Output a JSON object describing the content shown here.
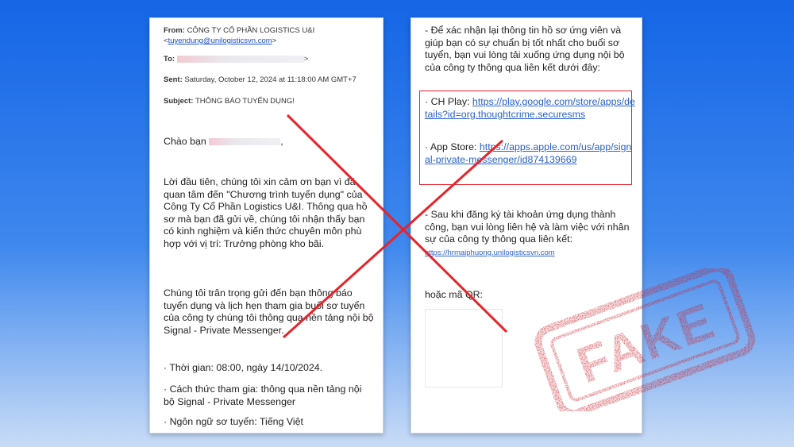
{
  "left": {
    "from_label": "From:",
    "from_value": "CÔNG TY CỔ PHẦN LOGISTICS U&I",
    "from_email": "tuyendung@unilogisticsvn.com",
    "to_label": "To:",
    "sent_label": "Sent:",
    "sent_value": "Saturday, October 12, 2024 at 11:18:00 AM GMT+7",
    "subject_label": "Subject:",
    "subject_value": "THÔNG BÁO TUYỂN DỤNG!",
    "greeting": "Chào bạn",
    "para1": "Lời đầu tiên, chúng tôi xin cảm ơn bạn vì đã quan tâm đến \"Chương trình tuyển dụng\" của Công Ty Cổ Phần Logistics U&I. Thông qua hồ sơ mà bạn đã gửi về, chúng tôi nhận thấy bạn có kinh nghiệm và kiến thức chuyên môn phù hợp với vị trí: Trưởng phòng kho bãi.",
    "para2": "Chúng tôi trân trọng gửi đến bạn thông báo tuyển dụng và lịch hẹn tham gia buổi sơ tuyển của công ty chúng tôi thông qua nền tảng nội bộ Signal - Private Messenger.",
    "bullet_time": "· Thời gian: 08:00, ngày 14/10/2024.",
    "bullet_method": "· Cách thức tham gia: thông qua nền tảng nội bộ Signal - Private Messenger",
    "bullet_lang": "· Ngôn ngữ sơ tuyển: Tiếng Việt"
  },
  "right": {
    "intro": "- Để xác nhận lại thông tin hồ sơ ứng viên và giúp bạn có sự chuẩn bị tốt nhất cho buổi sơ tuyển, bạn vui lòng tải xuống ứng dụng nội bộ của công ty thông qua liên kết dưới đây:",
    "chplay_label": "· CH Play:",
    "chplay_url": "https://play.google.com/store/apps/details?id=org.thoughtcrime.securesms",
    "appstore_label": "· App Store:",
    "appstore_url": "https://apps.apple.com/us/app/signal-private-messenger/id874139669",
    "after_text": "- Sau khi đăng ký tài khoản ứng dụng thành công, bạn vui lòng liên hệ và làm việc với nhân sự của công ty thông qua liên kết:",
    "contact_url": "https://hrmaiphuong.unilogisticsvn.com",
    "qr_label": "hoặc mã QR:"
  },
  "stamp": {
    "text": "FAKE",
    "color": "#c8202a"
  },
  "cross_color": "#e8232a"
}
